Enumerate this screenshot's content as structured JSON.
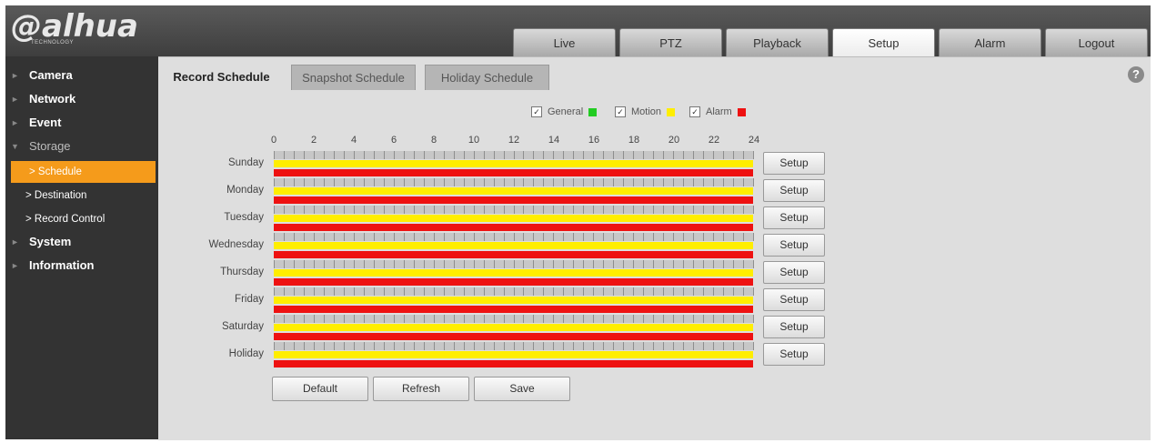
{
  "brand": {
    "logo": "alhua",
    "tagline": "TECHNOLOGY"
  },
  "nav": {
    "tabs": [
      {
        "label": "Live"
      },
      {
        "label": "PTZ"
      },
      {
        "label": "Playback"
      },
      {
        "label": "Setup",
        "active": true
      },
      {
        "label": "Alarm"
      },
      {
        "label": "Logout"
      }
    ]
  },
  "sidebar": {
    "items": [
      {
        "label": "Camera"
      },
      {
        "label": "Network"
      },
      {
        "label": "Event"
      },
      {
        "label": "Storage",
        "expanded": true
      },
      {
        "label": "System"
      },
      {
        "label": "Information"
      }
    ],
    "storage_children": [
      {
        "label": "Schedule",
        "active": true
      },
      {
        "label": "Destination"
      },
      {
        "label": "Record Control"
      }
    ]
  },
  "subtabs": [
    {
      "label": "Record Schedule",
      "active": true
    },
    {
      "label": "Snapshot Schedule"
    },
    {
      "label": "Holiday Schedule"
    }
  ],
  "help_icon": "?",
  "legend": [
    {
      "label": "General",
      "checked": true,
      "color": "#22cc22",
      "icon": "check-icon"
    },
    {
      "label": "Motion",
      "checked": true,
      "color": "#ffee00",
      "icon": "check-icon"
    },
    {
      "label": "Alarm",
      "checked": true,
      "color": "#ee1111",
      "icon": "check-icon"
    }
  ],
  "hours": [
    "0",
    "2",
    "4",
    "6",
    "8",
    "10",
    "12",
    "14",
    "16",
    "18",
    "20",
    "22",
    "24"
  ],
  "days": [
    "Sunday",
    "Monday",
    "Tuesday",
    "Wednesday",
    "Thursday",
    "Friday",
    "Saturday",
    "Holiday"
  ],
  "schedule_colors": {
    "motion": "#ffee00",
    "alarm": "#ee1111",
    "grid": "#c7c7c7"
  },
  "row_setup_label": "Setup",
  "actions": {
    "default_label": "Default",
    "refresh_label": "Refresh",
    "save_label": "Save"
  }
}
